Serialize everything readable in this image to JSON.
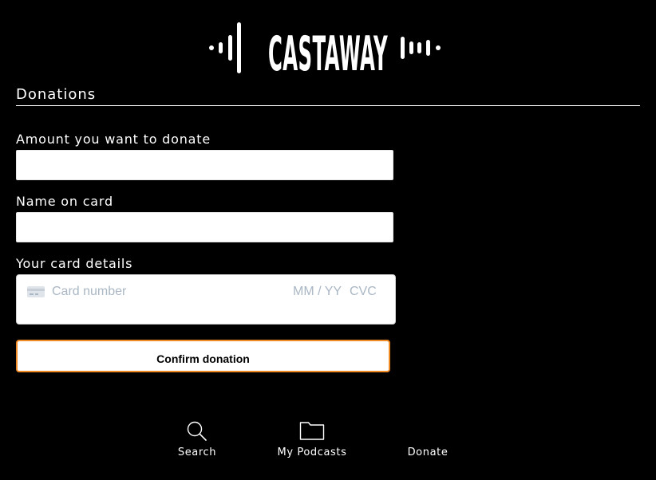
{
  "brand": {
    "name": "CASTAWAY",
    "logo_icon": "waveform-logo",
    "accent_color": "#f08a24"
  },
  "page": {
    "section_title": "Donations"
  },
  "form": {
    "amount_label": "Amount you want to donate",
    "amount_value": "",
    "name_label": "Name on card",
    "name_value": "",
    "card_label": "Your card details",
    "card_number_placeholder": "Card number",
    "card_expiry_placeholder": "MM / YY",
    "card_cvc_placeholder": "CVC",
    "card_icon": "credit-card-icon",
    "confirm_label": "Confirm donation"
  },
  "nav": {
    "items": [
      {
        "label": "Search",
        "icon": "search-icon"
      },
      {
        "label": "My Podcasts",
        "icon": "folder-icon"
      },
      {
        "label": "Donate",
        "icon": ""
      }
    ]
  }
}
